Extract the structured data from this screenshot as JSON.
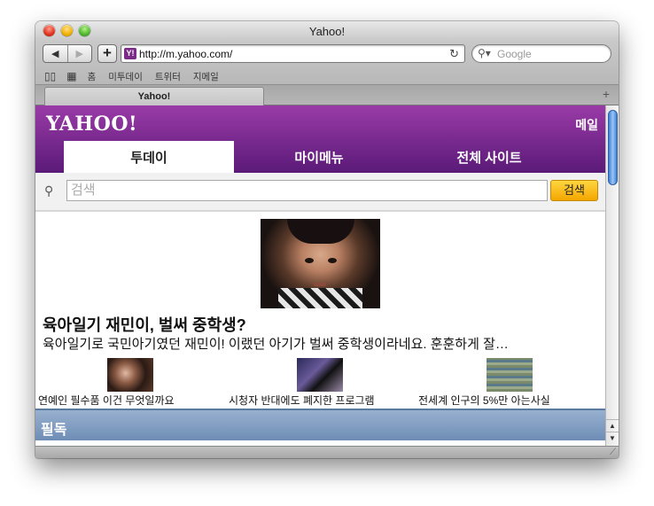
{
  "window": {
    "title": "Yahoo!"
  },
  "toolbar": {
    "back_icon": "back-arrow",
    "forward_icon": "forward-arrow",
    "add_label": "+",
    "url": "http://m.yahoo.com/",
    "favicon_text": "Y!",
    "search_placeholder": "Google",
    "bookmarks": [
      "홈",
      "미투데이",
      "트위터",
      "지메일"
    ]
  },
  "tab": {
    "label": "Yahoo!"
  },
  "page": {
    "logo": "YAHOO!",
    "mail_link": "메일",
    "tabs": [
      {
        "label": "투데이",
        "active": true
      },
      {
        "label": "마이메뉴",
        "active": false
      },
      {
        "label": "전체 사이트",
        "active": false
      }
    ],
    "search": {
      "placeholder": "검색",
      "button": "검색"
    },
    "headline": "육아일기 재민이, 벌써 중학생?",
    "summary": "육아일기로 국민아기였던 재민이! 이랬던 아기가 벌써 중학생이라네요. 훈훈하게 잘…",
    "stories": [
      {
        "caption": "연예인 필수품 이건 무엇일까요"
      },
      {
        "caption": "시청자 반대에도 폐지한 프로그램"
      },
      {
        "caption": "전세계 인구의 5%만 아는사실"
      }
    ],
    "section_title": "필독"
  },
  "colors": {
    "yahoo_purple": "#7b2b86",
    "search_button": "#f4a600",
    "section_blue": "#6e8db5"
  }
}
